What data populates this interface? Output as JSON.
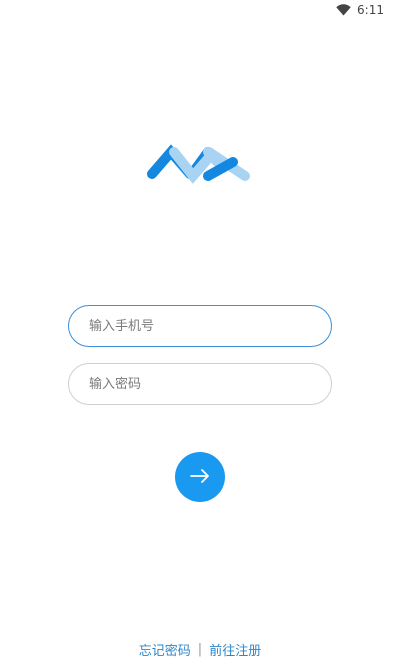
{
  "status_bar": {
    "time": "6:11",
    "wifi_icon": "wifi-icon"
  },
  "logo": {
    "icon": "app-logo-icon",
    "colors": {
      "dark": "#1487e0",
      "light": "#a9d3f2"
    }
  },
  "form": {
    "phone_placeholder": "输入手机号",
    "password_placeholder": "输入密码",
    "submit_icon": "arrow-right-icon",
    "accent_color": "#1a99f0"
  },
  "footer": {
    "forgot_password": "忘记密码",
    "separator": "|",
    "register": "前往注册"
  }
}
